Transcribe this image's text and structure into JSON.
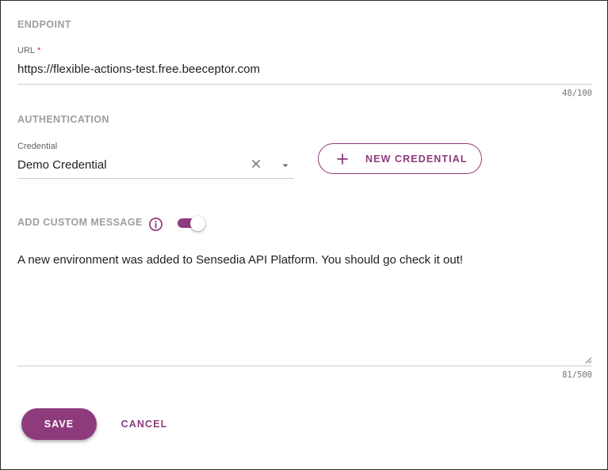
{
  "endpoint": {
    "section_label": "ENDPOINT",
    "url_label": "URL",
    "required_mark": "*",
    "url_value": "https://flexible-actions-test.free.beeceptor.com",
    "url_counter": "48/100"
  },
  "authentication": {
    "section_label": "AUTHENTICATION",
    "credential_label": "Credential",
    "credential_value": "Demo Credential",
    "clear_icon": "close-icon",
    "dropdown_icon": "caret-down-icon",
    "new_credential_label": "NEW CREDENTIAL"
  },
  "custom_message": {
    "section_label": "ADD CUSTOM MESSAGE",
    "info_icon": "info-icon",
    "enabled": true,
    "text": "A new environment was added to Sensedia API Platform. You should go check it out!",
    "counter": "81/500"
  },
  "actions": {
    "save_label": "SAVE",
    "cancel_label": "CANCEL"
  },
  "colors": {
    "accent": "#8e3b7d",
    "section_label": "#9e9e9e",
    "required": "#d32f2f"
  }
}
